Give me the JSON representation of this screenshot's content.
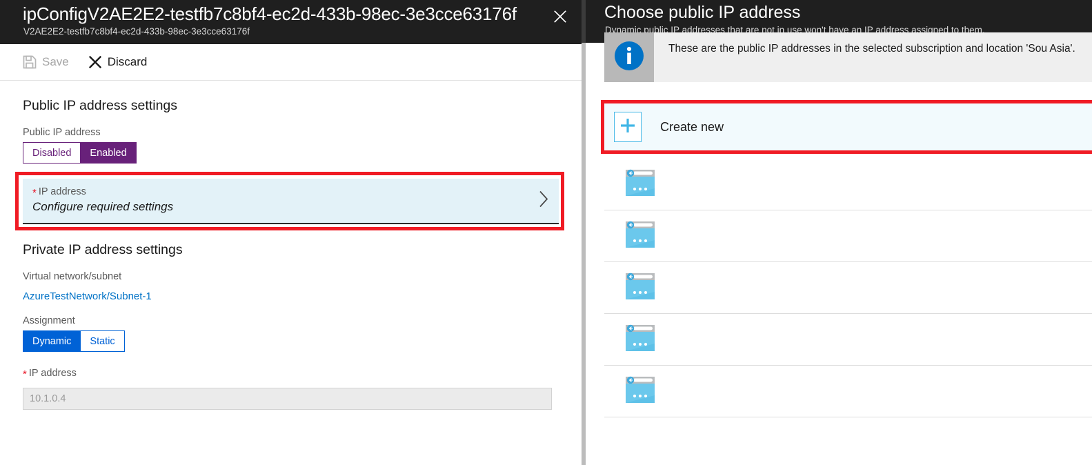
{
  "left_blade": {
    "title": "ipConfigV2AE2E2-testfb7c8bf4-ec2d-433b-98ec-3e3cce63176f",
    "subtitle": "V2AE2E2-testfb7c8bf4-ec2d-433b-98ec-3e3cce63176f",
    "close_icon": "close-icon",
    "toolbar": {
      "save_label": "Save",
      "save_icon": "save-disk-icon",
      "save_disabled": true,
      "discard_label": "Discard",
      "discard_icon": "discard-x-icon"
    },
    "public_section": {
      "heading": "Public IP address settings",
      "toggle_label": "Public IP address",
      "toggle_options": [
        "Disabled",
        "Enabled"
      ],
      "toggle_selected": "Enabled",
      "toggle_color": "#68217a",
      "ip_tile": {
        "label": "IP address",
        "required": true,
        "value": "Configure required settings",
        "chevron_icon": "chevron-right-icon",
        "highlight_color": "#f01b24"
      }
    },
    "private_section": {
      "heading": "Private IP address settings",
      "vnet_label": "Virtual network/subnet",
      "vnet_value": "AzureTestNetwork/Subnet-1",
      "assignment_label": "Assignment",
      "assignment_options": [
        "Dynamic",
        "Static"
      ],
      "assignment_selected": "Dynamic",
      "assignment_color": "#0062d6",
      "ip_label": "IP address",
      "ip_value": "10.1.0.4"
    }
  },
  "right_blade": {
    "title": "Choose public IP address",
    "subtitle": "Dynamic public IP addresses that are not in use won't have an IP address assigned to them.",
    "info": {
      "icon": "info-circle-icon",
      "message": "These are the public IP addresses in the selected subscription and location 'Sou Asia'."
    },
    "create_new": {
      "label": "Create new",
      "icon": "plus-icon",
      "highlight_color": "#f01b24"
    },
    "list_items": [
      {
        "icon": "public-ip-icon",
        "label": ""
      },
      {
        "icon": "public-ip-icon",
        "label": ""
      },
      {
        "icon": "public-ip-icon",
        "label": ""
      },
      {
        "icon": "public-ip-icon",
        "label": ""
      },
      {
        "icon": "public-ip-icon",
        "label": ""
      }
    ]
  }
}
